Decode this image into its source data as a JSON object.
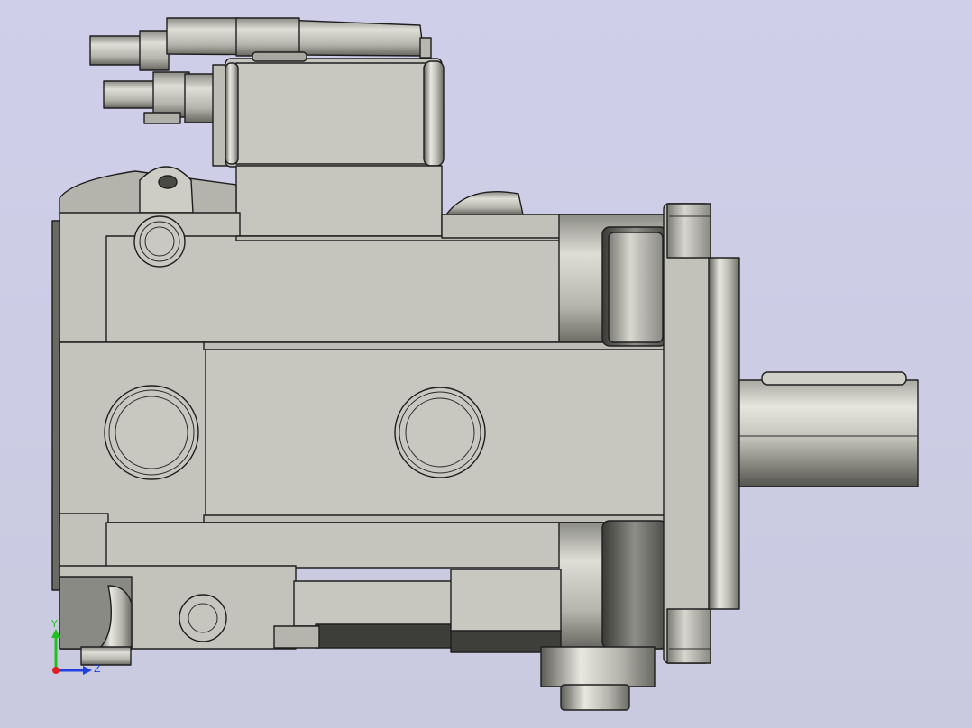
{
  "viewport": {
    "background_top": "#cfcfea",
    "background_bottom": "#c9c9df"
  },
  "model": {
    "body_color": "#c4c4bc",
    "shadow_color": "#55554f"
  },
  "triad": {
    "x_label": "",
    "y_label": "Y",
    "z_label": "Z",
    "x_color": "#e02020",
    "y_color": "#20c020",
    "z_color": "#2040e0"
  }
}
